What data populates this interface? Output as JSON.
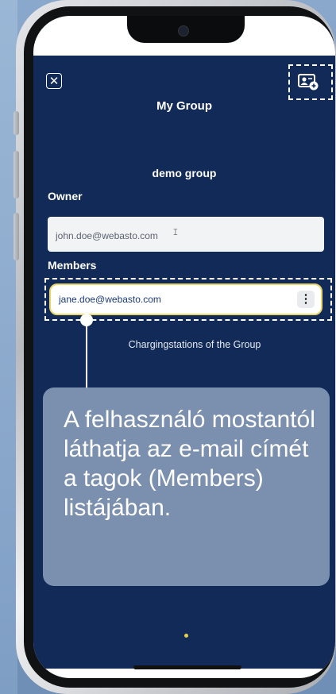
{
  "app": {
    "title": "My Group",
    "group_name": "demo group",
    "owner_label": "Owner",
    "owner_email": "john.doe@webasto.com",
    "members_label": "Members",
    "members": [
      {
        "email": "jane.doe@webasto.com",
        "more_icon": "more-vertical-icon"
      }
    ],
    "stations_label": "Chargingstations of the Group",
    "close_icon": "close-icon",
    "add_member_icon": "add-member-icon"
  },
  "callout": {
    "text": "A felhasználó mostantól láthatja az e-mail címét a tagok (Members) listájában."
  },
  "colors": {
    "app_background": "#112a57",
    "member_highlight_border": "#ecd66a",
    "callout_background": "#8094b2",
    "pager_dot": "#e8d04a"
  }
}
